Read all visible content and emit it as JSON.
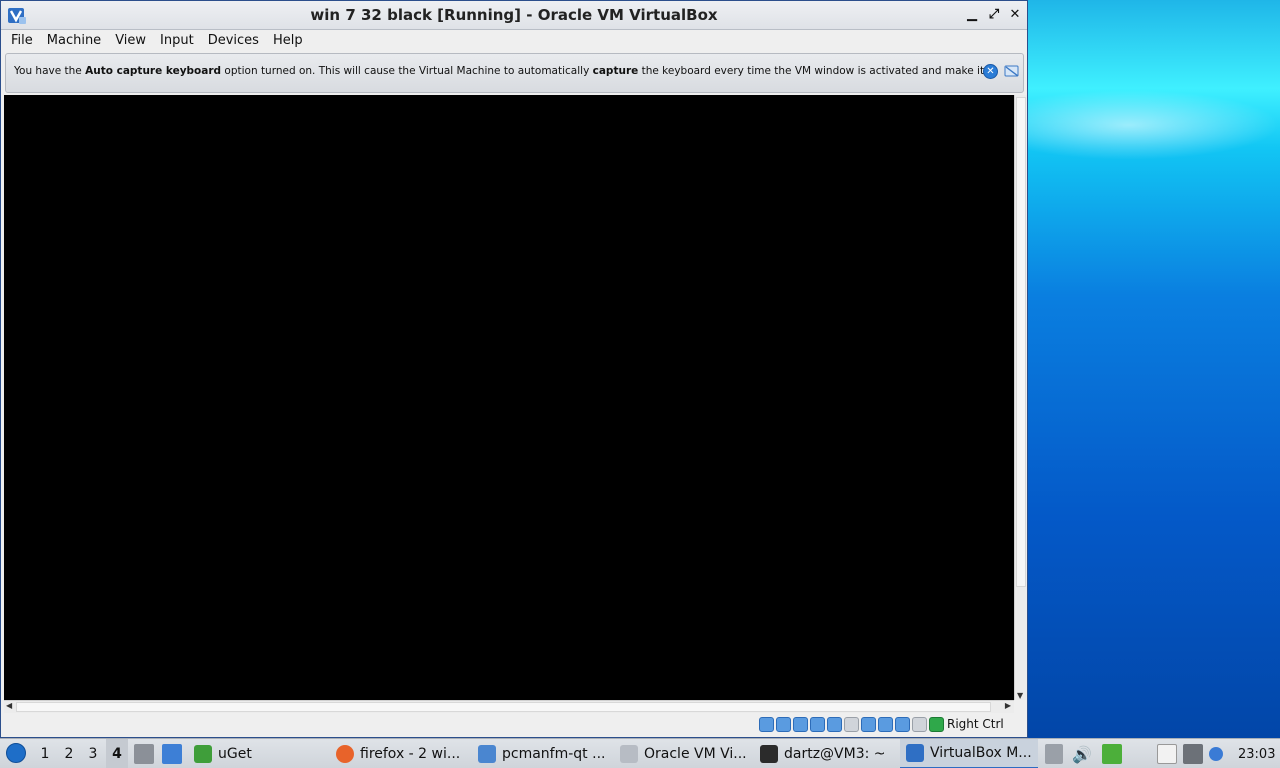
{
  "window": {
    "title": "win 7 32 black [Running] - Oracle VM VirtualBox",
    "controls": {
      "minimize": "▁",
      "maximize": "⤢",
      "close": "✕"
    }
  },
  "menubar": {
    "items": [
      "File",
      "Machine",
      "View",
      "Input",
      "Devices",
      "Help"
    ]
  },
  "notice": {
    "prefix": "You have the ",
    "bold1": "Auto capture keyboard",
    "middle": " option turned on. This will cause the Virtual Machine to automatically ",
    "bold2": "capture",
    "suffix": " the keyboard every time the VM window is activated and make it",
    "close_glyph": "✕"
  },
  "statusbar": {
    "host_key": "Right Ctrl",
    "icons": [
      "hard-disk-icon",
      "optical-drive-icon",
      "audio-icon",
      "network-icon",
      "usb-icon",
      "shared-folders-icon",
      "display-icon",
      "video-capture-icon",
      "mouse-integration-icon",
      "keyboard-icon",
      "cpu-icon",
      "host-key-icon"
    ]
  },
  "taskbar": {
    "desktops": [
      "1",
      "2",
      "3",
      "4"
    ],
    "active_desktop": "4",
    "tasks": [
      {
        "label": "uGet",
        "icon": "uget-icon"
      },
      {
        "label": "firefox - 2 wi...",
        "icon": "firefox-icon"
      },
      {
        "label": "pcmanfm-qt ...",
        "icon": "folder-icon"
      },
      {
        "label": "Oracle VM Vi...",
        "icon": "virtualbox-icon"
      },
      {
        "label": "dartz@VM3: ~",
        "icon": "terminal-icon"
      },
      {
        "label": "VirtualBox M...",
        "icon": "virtualbox-icon"
      }
    ],
    "clock": "23:03"
  },
  "colors": {
    "accent": "#2e6cc2",
    "vm_screen": "#000000"
  }
}
